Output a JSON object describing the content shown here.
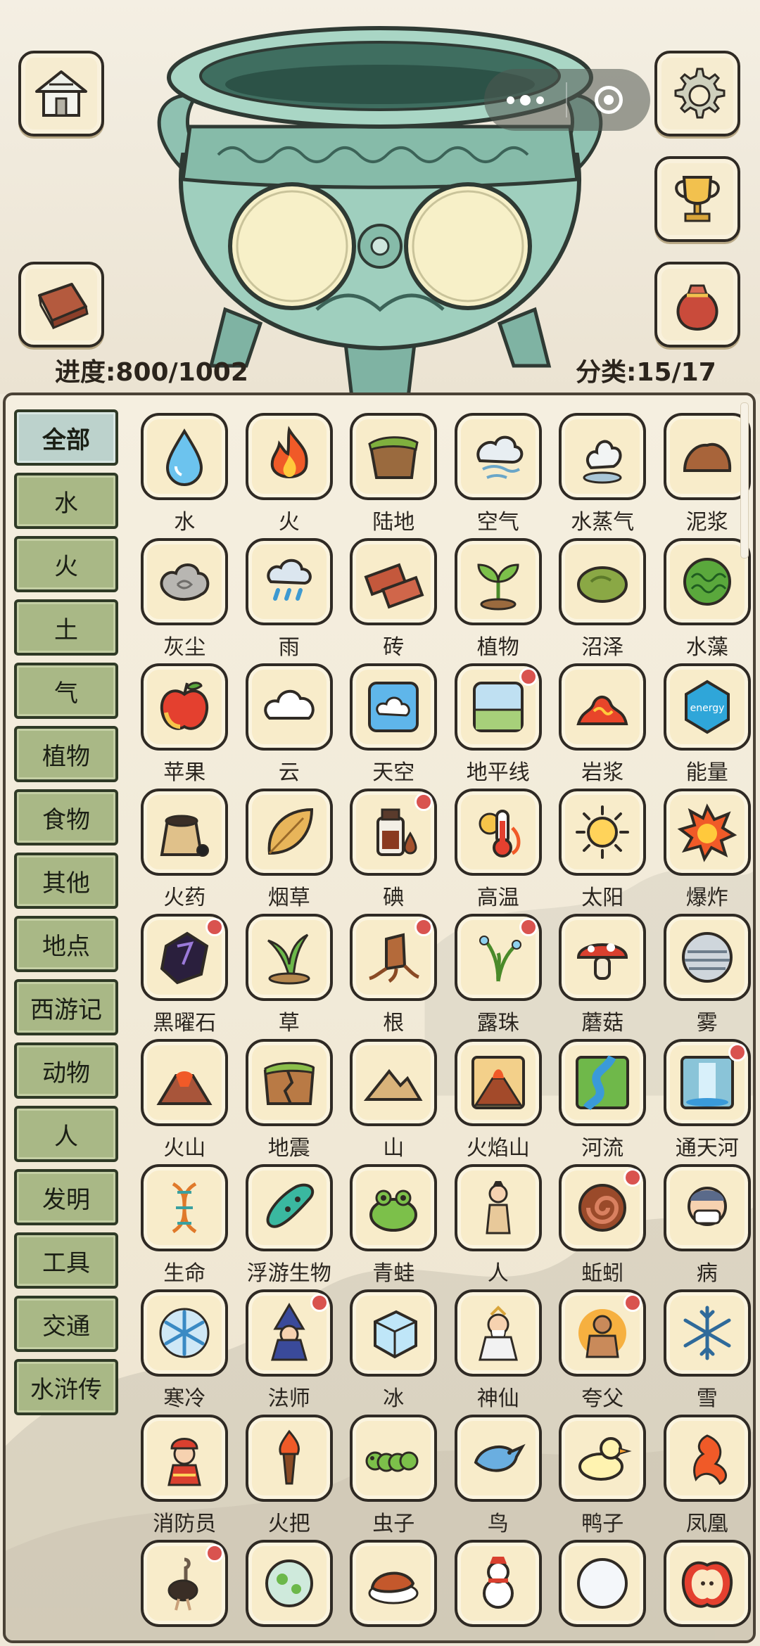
{
  "header": {
    "progress_text": "进度:800/1002",
    "category_text": "分类:15/17"
  },
  "top_buttons": [
    "home-icon",
    "book-icon",
    "gear-icon",
    "trophy-icon",
    "bag-icon"
  ],
  "categories": [
    {
      "label": "全部",
      "active": true
    },
    {
      "label": "水"
    },
    {
      "label": "火"
    },
    {
      "label": "土"
    },
    {
      "label": "气"
    },
    {
      "label": "植物"
    },
    {
      "label": "食物"
    },
    {
      "label": "其他"
    },
    {
      "label": "地点"
    },
    {
      "label": "西游记"
    },
    {
      "label": "动物"
    },
    {
      "label": "人"
    },
    {
      "label": "发明"
    },
    {
      "label": "工具"
    },
    {
      "label": "交通"
    },
    {
      "label": "水浒传"
    }
  ],
  "items": [
    {
      "label": "水",
      "icon": "water-drop",
      "dot": false
    },
    {
      "label": "火",
      "icon": "fire",
      "dot": false
    },
    {
      "label": "陆地",
      "icon": "land",
      "dot": false
    },
    {
      "label": "空气",
      "icon": "air",
      "dot": false
    },
    {
      "label": "水蒸气",
      "icon": "steam",
      "dot": false
    },
    {
      "label": "泥浆",
      "icon": "mud",
      "dot": false
    },
    {
      "label": "灰尘",
      "icon": "dust",
      "dot": false
    },
    {
      "label": "雨",
      "icon": "rain",
      "dot": false
    },
    {
      "label": "砖",
      "icon": "brick",
      "dot": false
    },
    {
      "label": "植物",
      "icon": "sprout",
      "dot": false
    },
    {
      "label": "沼泽",
      "icon": "swamp",
      "dot": false
    },
    {
      "label": "水藻",
      "icon": "algae",
      "dot": false
    },
    {
      "label": "苹果",
      "icon": "apple",
      "dot": false
    },
    {
      "label": "云",
      "icon": "cloud",
      "dot": false
    },
    {
      "label": "天空",
      "icon": "sky",
      "dot": false
    },
    {
      "label": "地平线",
      "icon": "horizon",
      "dot": true
    },
    {
      "label": "岩浆",
      "icon": "lava",
      "dot": false
    },
    {
      "label": "能量",
      "icon": "energy",
      "dot": false
    },
    {
      "label": "火药",
      "icon": "gunpowder",
      "dot": false
    },
    {
      "label": "烟草",
      "icon": "leaf",
      "dot": false
    },
    {
      "label": "碘",
      "icon": "iodine",
      "dot": true
    },
    {
      "label": "高温",
      "icon": "thermometer",
      "dot": false
    },
    {
      "label": "太阳",
      "icon": "sun",
      "dot": false
    },
    {
      "label": "爆炸",
      "icon": "explosion",
      "dot": false
    },
    {
      "label": "黑曜石",
      "icon": "obsidian",
      "dot": true
    },
    {
      "label": "草",
      "icon": "grass",
      "dot": false
    },
    {
      "label": "根",
      "icon": "root",
      "dot": true
    },
    {
      "label": "露珠",
      "icon": "dew",
      "dot": true
    },
    {
      "label": "蘑菇",
      "icon": "mushroom",
      "dot": false
    },
    {
      "label": "雾",
      "icon": "fog",
      "dot": false
    },
    {
      "label": "火山",
      "icon": "volcano",
      "dot": false
    },
    {
      "label": "地震",
      "icon": "earthquake",
      "dot": false
    },
    {
      "label": "山",
      "icon": "mountain",
      "dot": false
    },
    {
      "label": "火焰山",
      "icon": "flame-mountain",
      "dot": false
    },
    {
      "label": "河流",
      "icon": "river",
      "dot": false
    },
    {
      "label": "通天河",
      "icon": "waterfall",
      "dot": true
    },
    {
      "label": "生命",
      "icon": "dna",
      "dot": false
    },
    {
      "label": "浮游生物",
      "icon": "plankton",
      "dot": false
    },
    {
      "label": "青蛙",
      "icon": "frog",
      "dot": false
    },
    {
      "label": "人",
      "icon": "person",
      "dot": false
    },
    {
      "label": "蚯蚓",
      "icon": "worm",
      "dot": true
    },
    {
      "label": "病",
      "icon": "sick",
      "dot": false
    },
    {
      "label": "寒冷",
      "icon": "snowflake-blue",
      "dot": false
    },
    {
      "label": "法师",
      "icon": "wizard",
      "dot": true
    },
    {
      "label": "冰",
      "icon": "ice",
      "dot": false
    },
    {
      "label": "神仙",
      "icon": "immortal",
      "dot": false
    },
    {
      "label": "夸父",
      "icon": "kuafu",
      "dot": true
    },
    {
      "label": "雪",
      "icon": "snowflake",
      "dot": false
    },
    {
      "label": "消防员",
      "icon": "firefighter",
      "dot": false
    },
    {
      "label": "火把",
      "icon": "torch",
      "dot": false
    },
    {
      "label": "虫子",
      "icon": "caterpillar",
      "dot": false
    },
    {
      "label": "鸟",
      "icon": "bird",
      "dot": false
    },
    {
      "label": "鸭子",
      "icon": "duck",
      "dot": false
    },
    {
      "label": "凤凰",
      "icon": "phoenix",
      "dot": false
    },
    {
      "label": "",
      "icon": "ostrich",
      "dot": true
    },
    {
      "label": "",
      "icon": "cell",
      "dot": false
    },
    {
      "label": "",
      "icon": "roast-duck",
      "dot": false
    },
    {
      "label": "",
      "icon": "snowman",
      "dot": false
    },
    {
      "label": "",
      "icon": "snowball",
      "dot": false
    },
    {
      "label": "",
      "icon": "apple-slice",
      "dot": false
    }
  ]
}
